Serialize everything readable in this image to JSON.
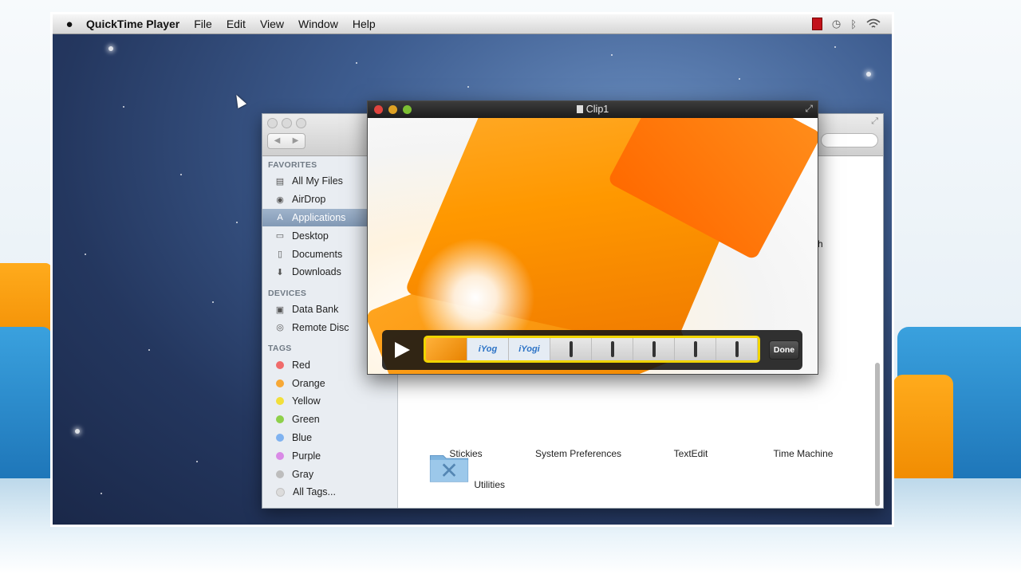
{
  "menubar": {
    "apple_icon": "apple-logo-icon",
    "app_name": "QuickTime Player",
    "items": [
      "File",
      "Edit",
      "View",
      "Window",
      "Help"
    ],
    "status_icons": [
      "recording-icon",
      "time-machine-icon",
      "bluetooth-icon",
      "wifi-icon"
    ]
  },
  "finder": {
    "favorites_header": "FAVORITES",
    "favorites": [
      {
        "label": "All My Files",
        "icon": "all-files-icon"
      },
      {
        "label": "AirDrop",
        "icon": "airdrop-icon"
      },
      {
        "label": "Applications",
        "icon": "applications-icon",
        "selected": true
      },
      {
        "label": "Desktop",
        "icon": "desktop-icon"
      },
      {
        "label": "Documents",
        "icon": "documents-icon"
      },
      {
        "label": "Downloads",
        "icon": "downloads-icon"
      }
    ],
    "devices_header": "DEVICES",
    "devices": [
      {
        "label": "Data Bank",
        "icon": "disk-icon"
      },
      {
        "label": "Remote Disc",
        "icon": "remote-disc-icon"
      }
    ],
    "tags_header": "TAGS",
    "tags": [
      {
        "label": "Red",
        "color": "#f06b6b"
      },
      {
        "label": "Orange",
        "color": "#f7a836"
      },
      {
        "label": "Yellow",
        "color": "#f2df3a"
      },
      {
        "label": "Green",
        "color": "#8ed04a"
      },
      {
        "label": "Blue",
        "color": "#7fb2f0"
      },
      {
        "label": "Purple",
        "color": "#d98ae6"
      },
      {
        "label": "Gray",
        "color": "#bdbdbd"
      },
      {
        "label": "All Tags...",
        "color": ""
      }
    ],
    "apps": [
      {
        "label": "Stickies"
      },
      {
        "label": "System Preferences"
      },
      {
        "label": "TextEdit"
      },
      {
        "label": "Time Machine"
      },
      {
        "label": "Utilities"
      }
    ],
    "partial_label": "oth"
  },
  "quicktime": {
    "title": "Clip1",
    "done_label": "Done",
    "filmstrip_logo_a": "iYog",
    "filmstrip_logo_b": "iYogi"
  },
  "colors": {
    "selection": "#8299b5",
    "trim_handle": "#f0d400",
    "video_orange": "#ff9800"
  }
}
